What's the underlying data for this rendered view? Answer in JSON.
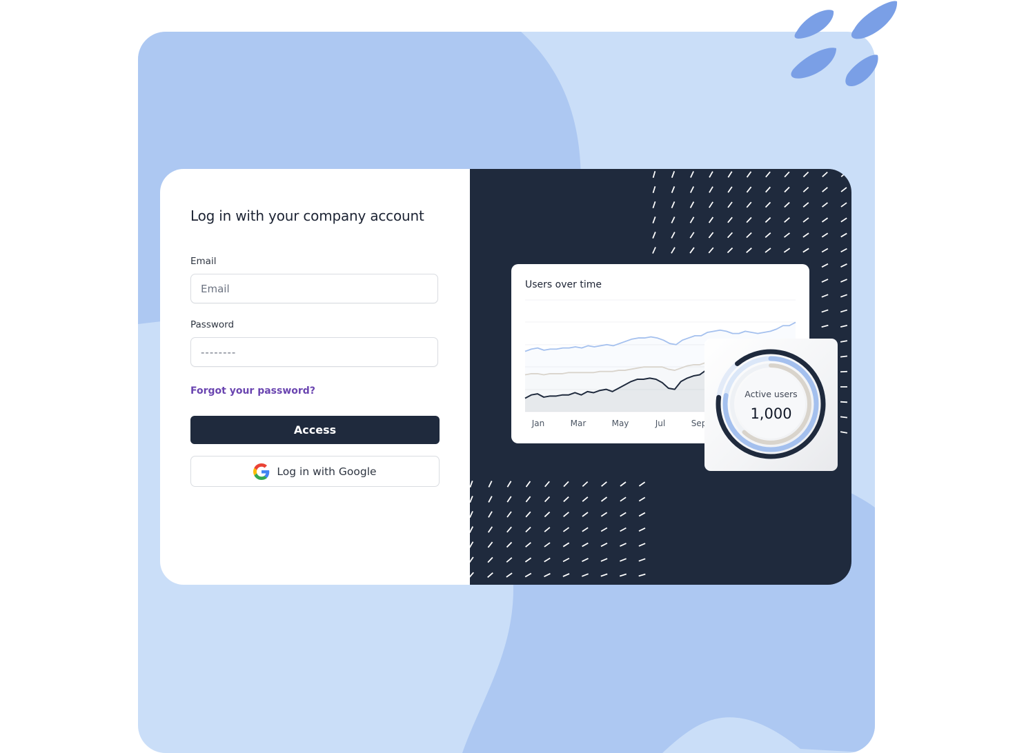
{
  "login": {
    "title": "Log in with your company account",
    "email_label": "Email",
    "email_placeholder": "Email",
    "email_value": "",
    "password_label": "Password",
    "password_placeholder": "--------",
    "password_value": "",
    "forgot_link": "Forgot your password?",
    "access_button": "Access",
    "google_button": "Log in with Google"
  },
  "colors": {
    "primary_dark": "#1f2a3d",
    "link_purple": "#6a45b0",
    "bg_light_blue": "#cadef8",
    "bg_mid_blue": "#adc8f2",
    "accent_blue": "#7a9fe6",
    "series_blue": "#a4c0ee",
    "series_grey": "#d9d4cc",
    "series_dark": "#1f2a3d"
  },
  "icons": {
    "google": "google-g-icon"
  },
  "chart_data": [
    {
      "type": "line",
      "title": "Users over time",
      "xlabel": "",
      "ylabel": "",
      "x_tick_labels": [
        "Jan",
        "Mar",
        "May",
        "Jul",
        "Sep"
      ],
      "grid": true,
      "legend": "none",
      "ylim": [
        0,
        100
      ],
      "series": [
        {
          "name": "blue",
          "color": "#a4c0ee",
          "values": [
            54,
            56,
            57,
            55,
            56,
            56,
            57,
            57,
            58,
            57,
            59,
            58,
            59,
            60,
            59,
            61,
            63,
            65,
            66,
            66,
            67,
            66,
            64,
            61,
            60,
            64,
            66,
            68,
            68,
            71,
            72,
            73,
            72,
            70,
            70,
            72,
            71,
            70,
            71,
            72,
            74,
            77,
            77,
            80
          ]
        },
        {
          "name": "grey",
          "color": "#d9d4cc",
          "values": [
            33,
            34,
            34,
            33,
            34,
            34,
            34,
            35,
            35,
            35,
            35,
            35,
            36,
            36,
            36,
            37,
            37,
            38,
            39,
            40,
            40,
            40,
            40,
            38,
            37,
            39,
            41,
            42,
            42,
            44
          ]
        },
        {
          "name": "dark",
          "color": "#1f2a3d",
          "values": [
            12,
            15,
            16,
            13,
            14,
            14,
            15,
            15,
            17,
            15,
            18,
            17,
            19,
            20,
            18,
            21,
            24,
            27,
            29,
            29,
            30,
            29,
            26,
            21,
            20,
            27,
            30,
            32,
            33,
            37
          ]
        }
      ]
    },
    {
      "type": "pie",
      "title": "Active users",
      "value_label": "1,000",
      "rings": [
        {
          "name": "outer",
          "color": "#1f2a3d",
          "fraction": 0.88
        },
        {
          "name": "middle",
          "color": "#a4c0ee",
          "fraction": 0.78
        },
        {
          "name": "inner",
          "color": "#d9d4cc",
          "fraction": 0.62
        }
      ]
    }
  ]
}
